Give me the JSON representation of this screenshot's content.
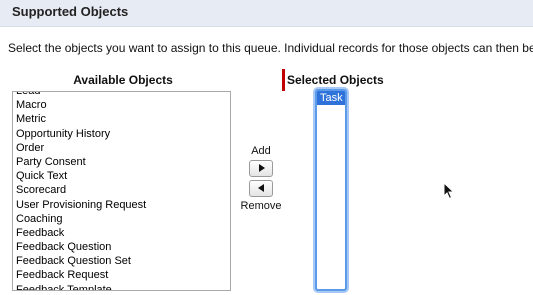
{
  "section": {
    "title": "Supported Objects",
    "instructions": "Select the objects you want to assign to this queue. Individual records for those objects can then be own"
  },
  "available": {
    "heading": "Available Objects",
    "items": [
      "Lead",
      "Macro",
      "Metric",
      "Opportunity History",
      "Order",
      "Party Consent",
      "Quick Text",
      "Scorecard",
      "User Provisioning Request",
      "Coaching",
      "Feedback",
      "Feedback Question",
      "Feedback Question Set",
      "Feedback Request",
      "Feedback Template"
    ]
  },
  "controls": {
    "add_label": "Add",
    "remove_label": "Remove",
    "add_icon": "arrow-right-icon",
    "remove_icon": "arrow-left-icon"
  },
  "selected": {
    "heading": "Selected Objects",
    "items": [
      "Task"
    ]
  },
  "colors": {
    "header_bg": "#e7ebf3",
    "required_marker": "#c00000",
    "selection_bg": "#2f72d9",
    "focus_ring": "#5b9bea"
  }
}
